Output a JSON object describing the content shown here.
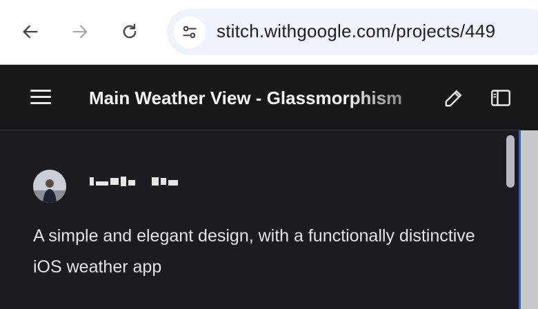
{
  "browser": {
    "back_icon": "arrow-left-icon",
    "forward_icon": "arrow-right-icon",
    "reload_icon": "reload-icon",
    "site_info_icon": "tune-icon",
    "url": "stitch.withgoogle.com/projects/449"
  },
  "header": {
    "menu_icon": "hamburger-menu-icon",
    "title": "Main Weather View - Glassmorphism",
    "edit_icon": "pencil-icon",
    "panel_icon": "sidebar-panel-icon"
  },
  "post": {
    "description": "A simple and elegant design, with a functionally distinctive iOS weather app"
  },
  "colors": {
    "app_background": "#1c1c20",
    "header_background": "#18181b",
    "omnibox_background": "#eef2fb",
    "accent_line": "#2a60c8"
  }
}
